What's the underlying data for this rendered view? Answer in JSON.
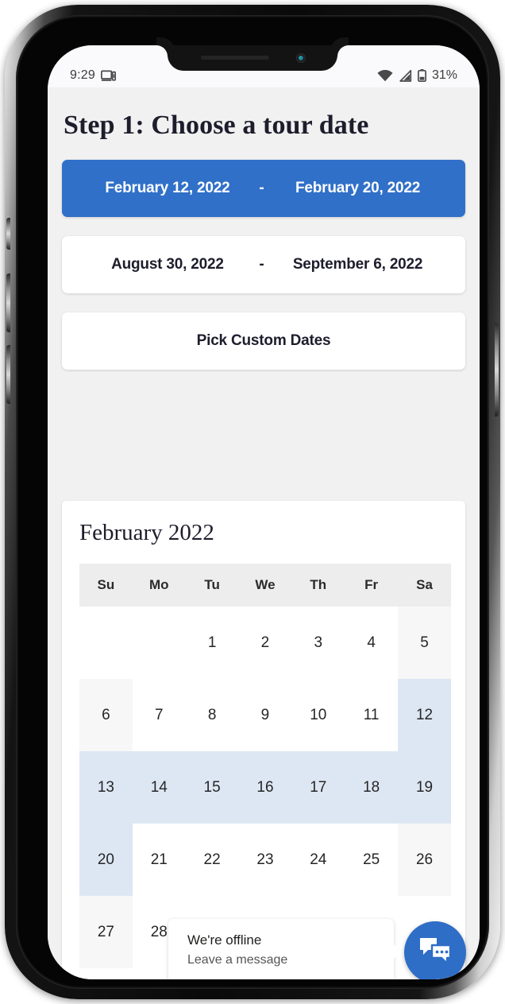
{
  "status_bar": {
    "time": "9:29",
    "cast_icon": "device-cast-icon",
    "wifi_icon": "wifi-icon",
    "signal_icon": "signal-icon",
    "battery_icon": "battery-icon",
    "battery_percent": "31%"
  },
  "page": {
    "title": "Step 1: Choose a tour date"
  },
  "date_options": [
    {
      "name": "preset-range-1",
      "from": "February 12, 2022",
      "separator": "-",
      "to": "February 20, 2022",
      "selected": true
    },
    {
      "name": "preset-range-2",
      "from": "August 30, 2022",
      "separator": "-",
      "to": "September 6, 2022",
      "selected": false
    }
  ],
  "custom_dates_label": "Pick Custom Dates",
  "calendar": {
    "month_label": "February 2022",
    "weekday_headers": [
      "Su",
      "Mo",
      "Tu",
      "We",
      "Th",
      "Fr",
      "Sa"
    ],
    "weeks": [
      [
        {
          "day": "",
          "state": "empty"
        },
        {
          "day": "",
          "state": "empty"
        },
        {
          "day": "1",
          "state": "normal"
        },
        {
          "day": "2",
          "state": "normal"
        },
        {
          "day": "3",
          "state": "normal"
        },
        {
          "day": "4",
          "state": "normal"
        },
        {
          "day": "5",
          "state": "weekend"
        }
      ],
      [
        {
          "day": "6",
          "state": "weekend"
        },
        {
          "day": "7",
          "state": "normal"
        },
        {
          "day": "8",
          "state": "normal"
        },
        {
          "day": "9",
          "state": "normal"
        },
        {
          "day": "10",
          "state": "normal"
        },
        {
          "day": "11",
          "state": "normal"
        },
        {
          "day": "12",
          "state": "in-range"
        }
      ],
      [
        {
          "day": "13",
          "state": "in-range"
        },
        {
          "day": "14",
          "state": "in-range"
        },
        {
          "day": "15",
          "state": "in-range"
        },
        {
          "day": "16",
          "state": "in-range"
        },
        {
          "day": "17",
          "state": "in-range"
        },
        {
          "day": "18",
          "state": "in-range"
        },
        {
          "day": "19",
          "state": "in-range"
        }
      ],
      [
        {
          "day": "20",
          "state": "in-range"
        },
        {
          "day": "21",
          "state": "normal"
        },
        {
          "day": "22",
          "state": "normal"
        },
        {
          "day": "23",
          "state": "normal"
        },
        {
          "day": "24",
          "state": "normal"
        },
        {
          "day": "25",
          "state": "normal"
        },
        {
          "day": "26",
          "state": "weekend"
        }
      ],
      [
        {
          "day": "27",
          "state": "weekend"
        },
        {
          "day": "28",
          "state": "normal"
        },
        {
          "day": "",
          "state": "empty"
        },
        {
          "day": "",
          "state": "empty"
        },
        {
          "day": "",
          "state": "empty"
        },
        {
          "day": "",
          "state": "empty"
        },
        {
          "day": "",
          "state": "empty"
        }
      ]
    ]
  },
  "chat_widget": {
    "title": "We're offline",
    "subtitle": "Leave a message",
    "launcher_icon": "chat-bubbles-icon"
  },
  "colors": {
    "accent_blue": "#3070c8",
    "chat_blue": "#2f6ec6",
    "range_highlight": "#dde7f4",
    "weekend_tint": "#f7f7f7",
    "page_background": "#f1f1f1",
    "heading_text": "#1d1d2c"
  }
}
